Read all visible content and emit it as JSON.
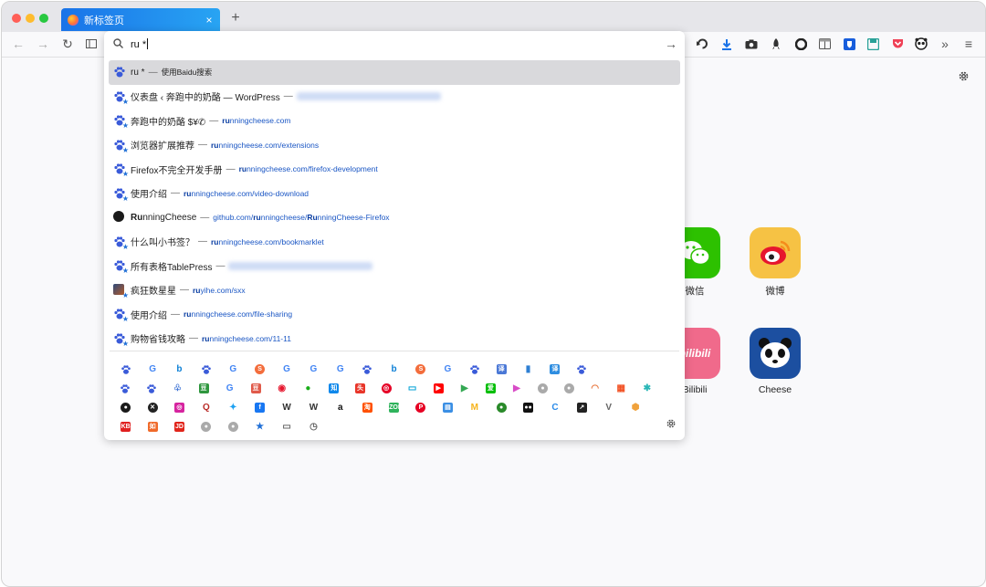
{
  "tab": {
    "title": "新标签页",
    "close_glyph": "×"
  },
  "newtab_glyph": "+",
  "urlbar": {
    "value": "ru *"
  },
  "results": [
    {
      "icon": "baidu",
      "title": "ru * ",
      "sep": "—",
      "url_prefix": "",
      "url_rest": "使用Baidu搜索",
      "blurred": false
    },
    {
      "icon": "baidu",
      "title": "仪表盘 ‹ 奔跑中的奶酪 — WordPress",
      "sep": "—",
      "url_prefix": "",
      "url_rest": "",
      "blurred": true
    },
    {
      "icon": "baidu",
      "title": "奔跑中的奶酪 $¥✆",
      "sep": "—",
      "url_prefix": "ru",
      "url_rest": "nningcheese.com",
      "blurred": false
    },
    {
      "icon": "baidu",
      "title": "浏览器扩展推荐",
      "sep": "—",
      "url_prefix": "ru",
      "url_rest": "nningcheese.com/extensions",
      "blurred": false
    },
    {
      "icon": "baidu",
      "title": "Firefox不完全开发手册",
      "sep": "—",
      "url_prefix": "ru",
      "url_rest": "nningcheese.com/firefox-development",
      "blurred": false
    },
    {
      "icon": "baidu",
      "title": "使用介绍",
      "sep": "—",
      "url_prefix": "ru",
      "url_rest": "nningcheese.com/video-download",
      "blurred": false
    },
    {
      "icon": "github",
      "title_bold": "Ru",
      "title": "nningCheese",
      "sep": "—",
      "url_pre": "github.com/",
      "url_prefix": "ru",
      "url_mid": "nningcheese/",
      "url_bold2": "Ru",
      "url_rest": "nningCheese-Firefox",
      "blurred": false
    },
    {
      "icon": "baidu",
      "title": "什么叫小书签？",
      "sep": "—",
      "url_prefix": "ru",
      "url_rest": "nningcheese.com/bookmarklet",
      "blurred": false
    },
    {
      "icon": "baidu",
      "title": "所有表格TablePress",
      "sep": "—",
      "url_prefix": "",
      "url_rest": "",
      "blurred": true
    },
    {
      "icon": "avatar",
      "title": "疯狂数星星",
      "sep": "—",
      "url_prefix": "ru",
      "url_rest": "yihe.com/sxx",
      "blurred": false
    },
    {
      "icon": "baidu",
      "title": "使用介绍",
      "sep": "—",
      "url_prefix": "ru",
      "url_rest": "nningcheese.com/file-sharing",
      "blurred": false
    },
    {
      "icon": "baidu",
      "title": "购物省钱攻略",
      "sep": "—",
      "url_prefix": "ru",
      "url_rest": "nningcheese.com/11-11",
      "blurred": false
    }
  ],
  "engines": [
    [
      {
        "n": "baidu"
      },
      {
        "n": "google",
        "g": "G",
        "c": "#4285f4"
      },
      {
        "n": "bing",
        "g": "b",
        "c": "#0c7fd6"
      },
      {
        "n": "baidu"
      },
      {
        "n": "google",
        "g": "G",
        "c": "#4285f4"
      },
      {
        "n": "sogou",
        "g": "S",
        "c": "#f36d3c",
        "shape": "circ"
      },
      {
        "n": "google",
        "g": "G",
        "c": "#4285f4"
      },
      {
        "n": "google",
        "g": "G",
        "c": "#4285f4"
      },
      {
        "n": "google",
        "g": "G",
        "c": "#4285f4"
      },
      {
        "n": "baidu"
      },
      {
        "n": "bing",
        "g": "b",
        "c": "#0c7fd6"
      },
      {
        "n": "sogou",
        "g": "S",
        "c": "#f36d3c",
        "shape": "circ"
      },
      {
        "n": "google",
        "g": "G",
        "c": "#4285f4"
      },
      {
        "n": "baidu"
      },
      {
        "n": "translate",
        "g": "译",
        "c": "#4a78d6",
        "shape": "sq"
      },
      {
        "n": "dict",
        "g": "▮",
        "c": "#2e7fd3"
      },
      {
        "n": "translate",
        "g": "译",
        "c": "#2e8de0",
        "shape": "sq"
      },
      {
        "n": "baidu"
      }
    ],
    [
      {
        "n": "baidu"
      },
      {
        "n": "baidu"
      },
      {
        "n": "baidu-share",
        "g": "♧",
        "c": "#3069d2"
      },
      {
        "n": "douban",
        "g": "豆",
        "c": "#2e963d",
        "shape": "sq"
      },
      {
        "n": "google",
        "g": "G",
        "c": "#4285f4"
      },
      {
        "n": "douban-book",
        "g": "豆",
        "c": "#e05a4a",
        "shape": "sq"
      },
      {
        "n": "weibo",
        "g": "◉",
        "c": "#e6162d"
      },
      {
        "n": "wechat",
        "g": "●",
        "c": "#1aad19"
      },
      {
        "n": "zhihu",
        "g": "知",
        "c": "#0f88eb",
        "shape": "sq"
      },
      {
        "n": "toutiao",
        "g": "头",
        "c": "#e8362a",
        "shape": "sq"
      },
      {
        "n": "netease",
        "g": "◎",
        "c": "#e60026",
        "shape": "circ"
      },
      {
        "n": "bilibili",
        "g": "▭",
        "c": "#00a1d6"
      },
      {
        "n": "youtube",
        "g": "▶",
        "c": "#ff0000",
        "shape": "sq"
      },
      {
        "n": "play",
        "g": "▶",
        "c": "#34a853"
      },
      {
        "n": "iqiyi",
        "g": "爱",
        "c": "#00be06",
        "shape": "sq"
      },
      {
        "n": "youku",
        "g": "▶",
        "c": "#d84cc7"
      },
      {
        "n": "search",
        "g": "●",
        "c": "#aaaaaa",
        "shape": "circ"
      },
      {
        "n": "search",
        "g": "●",
        "c": "#aaaaaa",
        "shape": "circ"
      },
      {
        "n": "rainbow",
        "g": "◠",
        "c": "#e8743b"
      },
      {
        "n": "microsoft",
        "g": "▦",
        "c": "#f25022"
      },
      {
        "n": "puzzle",
        "g": "✱",
        "c": "#2ab7b7"
      }
    ],
    [
      {
        "n": "github",
        "g": "●",
        "c": "#1a1a1a",
        "shape": "circ"
      },
      {
        "n": "x",
        "g": "✕",
        "c": "#222222",
        "shape": "circ"
      },
      {
        "n": "instagram",
        "g": "◎",
        "c": "#d6249f",
        "shape": "sq"
      },
      {
        "n": "quora",
        "g": "Q",
        "c": "#b92b27"
      },
      {
        "n": "twitter",
        "g": "✦",
        "c": "#1da1f2"
      },
      {
        "n": "facebook",
        "g": "f",
        "c": "#1877f2",
        "shape": "sq"
      },
      {
        "n": "wikipedia",
        "g": "W",
        "c": "#333333"
      },
      {
        "n": "wikipedia",
        "g": "W",
        "c": "#333333"
      },
      {
        "n": "amazon",
        "g": "a",
        "c": "#111111"
      },
      {
        "n": "taobao",
        "g": "淘",
        "c": "#ff5000",
        "shape": "sq"
      },
      {
        "n": "zol",
        "g": "ZOL",
        "c": "#2fb35c",
        "shape": "sq"
      },
      {
        "n": "pinterest",
        "g": "P",
        "c": "#e60023",
        "shape": "circ"
      },
      {
        "n": "icon",
        "g": "▤",
        "c": "#3b8fe4",
        "shape": "sq"
      },
      {
        "n": "mi",
        "g": "M",
        "c": "#f6b31b"
      },
      {
        "n": "circle",
        "g": "●",
        "c": "#2a8a2a",
        "shape": "circ"
      },
      {
        "n": "medium",
        "g": "●●",
        "c": "#111111",
        "shape": "sq"
      },
      {
        "n": "chrome-c",
        "g": "C",
        "c": "#2a8ae8"
      },
      {
        "n": "arrow",
        "g": "↗",
        "c": "#222222",
        "shape": "sq"
      },
      {
        "n": "v",
        "g": "V",
        "c": "#666666"
      },
      {
        "n": "hex",
        "g": "⬢",
        "c": "#f0a23c"
      }
    ],
    [
      {
        "n": "kyb",
        "g": "KB",
        "c": "#e02020",
        "shape": "sq"
      },
      {
        "n": "ruyi",
        "g": "如",
        "c": "#f06a2a",
        "shape": "sq"
      },
      {
        "n": "jd",
        "g": "JD",
        "c": "#e1251b",
        "shape": "sq"
      },
      {
        "n": "search",
        "g": "●",
        "c": "#aaaaaa",
        "shape": "circ"
      },
      {
        "n": "search",
        "g": "●",
        "c": "#aaaaaa",
        "shape": "circ"
      },
      {
        "n": "star",
        "g": "★",
        "c": "#1f6fd6"
      },
      {
        "n": "window",
        "g": "▭",
        "c": "#666666"
      },
      {
        "n": "clock",
        "g": "◷",
        "c": "#666666"
      }
    ]
  ],
  "sites": [
    {
      "name": "微信",
      "color": "#2dc100",
      "glyph": "●●"
    },
    {
      "name": "微博",
      "color": "#f6c244",
      "glyph": "◉"
    },
    {
      "name": "Bilibili",
      "color": "#f06a8b",
      "glyph": "bilibili"
    },
    {
      "name": "Cheese",
      "color": "#1c4fa0",
      "glyph": "🐼"
    }
  ]
}
